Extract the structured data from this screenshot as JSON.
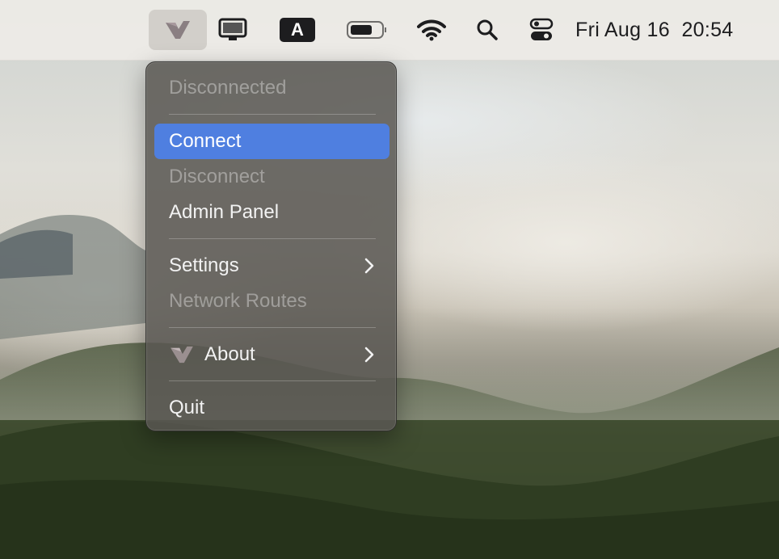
{
  "menubar": {
    "app_icon": "app-logo-icon",
    "display_icon": "display-icon",
    "input_source": "A",
    "battery_icon": "battery-icon",
    "wifi_icon": "wifi-icon",
    "search_icon": "search-icon",
    "control_center_icon": "control-center-icon",
    "clock": "Fri Aug 16  20:54"
  },
  "menu": {
    "status": "Disconnected",
    "connect": "Connect",
    "disconnect": "Disconnect",
    "admin_panel": "Admin Panel",
    "settings": "Settings",
    "network_routes": "Network Routes",
    "about": "About",
    "quit": "Quit"
  },
  "colors": {
    "highlight": "#4f7fe0",
    "menu_bg": "#585652",
    "menubar_bg": "#eceae6"
  }
}
